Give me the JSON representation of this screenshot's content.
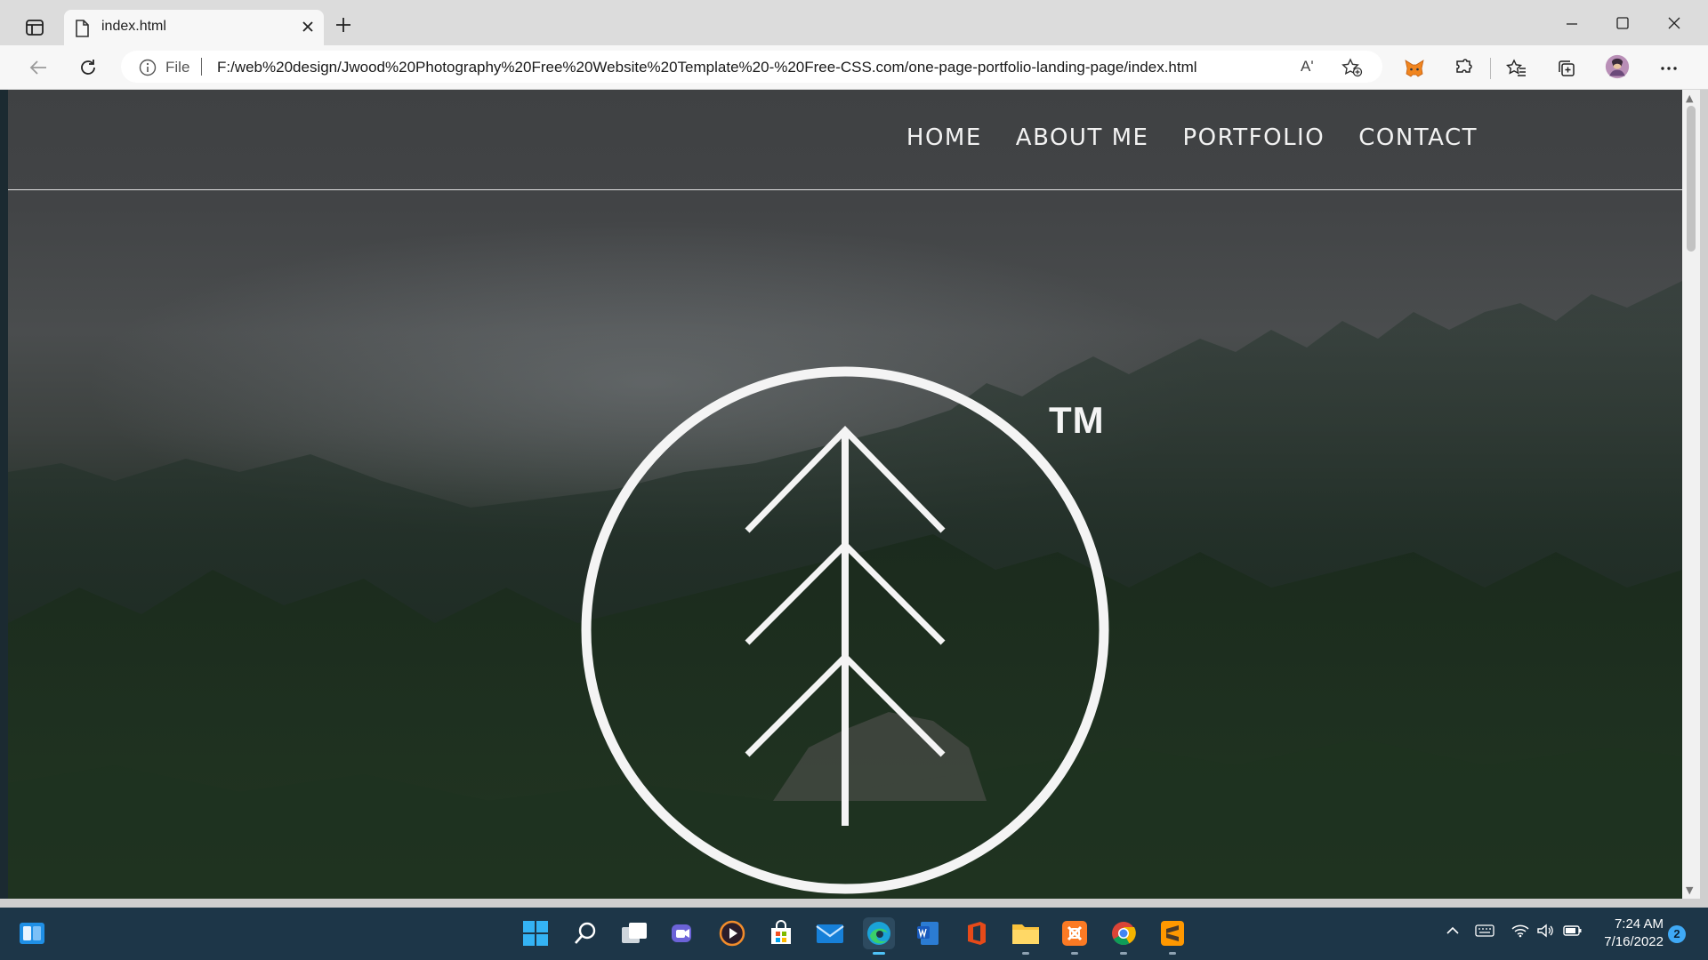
{
  "browser": {
    "tab_title": "index.html",
    "address": {
      "scheme_label": "File",
      "url": "F:/web%20design/Jwood%20Photography%20Free%20Website%20Template%20-%20Free-CSS.com/one-page-portfolio-landing-page/index.html",
      "read_aloud_glyph": "Aʹ"
    },
    "icons": [
      "sidebar-icon",
      "page-icon",
      "close-icon",
      "new-tab-icon",
      "minimize-icon",
      "maximize-icon",
      "window-close-icon",
      "back-icon",
      "refresh-icon",
      "info-icon",
      "add-favorite-icon",
      "metamask-icon",
      "extensions-icon",
      "favorites-icon",
      "collections-icon",
      "profile-icon",
      "more-icon"
    ]
  },
  "site": {
    "nav": [
      "HOME",
      "ABOUT ME",
      "PORTFOLIO",
      "CONTACT"
    ],
    "logo_mark": "TM"
  },
  "taskbar": {
    "apps": [
      "start",
      "search",
      "task-view",
      "teams",
      "media-player",
      "store",
      "mail",
      "edge",
      "word",
      "office",
      "file-explorer",
      "xampp",
      "chrome",
      "sublime"
    ],
    "clock_time": "7:24 AM",
    "clock_date": "7/16/2022",
    "notification_count": "2"
  },
  "colors": {
    "taskbar": "#1d3648",
    "accent": "#3fa9f5",
    "nav_text": "#f2f2f2"
  }
}
